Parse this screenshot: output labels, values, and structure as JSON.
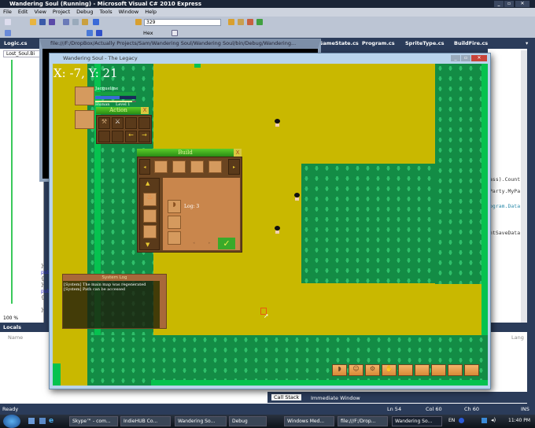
{
  "ide": {
    "title": "Wandering Soul (Running) - Microsoft Visual C# 2010 Express",
    "menu": [
      "File",
      "Edit",
      "View",
      "Project",
      "Debug",
      "Tools",
      "Window",
      "Help"
    ],
    "find_value": "329",
    "hex_label": "Hex",
    "tabs_left": [
      "Logic.cs"
    ],
    "tabs_right": [
      "GameState.cs",
      "Program.cs",
      "SpriteType.cs",
      "BuildFire.cs"
    ],
    "member_dropdown": "Lost_Soul.Bi",
    "code_left": [
      "}",
      "publ",
      "{",
      "}",
      "publ",
      "{",
      "}"
    ],
    "code_right": [
      "ass).Count)",
      "Party.MyPar",
      "ogram.Data.D",
      "ntSaveData]"
    ],
    "zoom": "100 %",
    "locals_title": "Locals",
    "locals_col": "Name",
    "right_col": "Lang",
    "bottom_tabs": [
      "Call Stack",
      "Immediate Window"
    ],
    "status": {
      "ready": "Ready",
      "ln": "Ln 54",
      "col": "Col 60",
      "ch": "Ch 60",
      "mode": "INS"
    }
  },
  "console": {
    "title": "file:///F:/DropBox/Actually Projects/Sam/Wandering Soul/Wandering Soul/bin/Debug/Wandering..."
  },
  "game": {
    "title": "Wandering Soul - The Legacy",
    "coords": "X: -7, Y: 21",
    "player": {
      "name": "Jacqueline",
      "race": "Human",
      "level": "Level 1",
      "health": 1.0,
      "mana": 0.6,
      "xp": 0.9
    },
    "action": {
      "title": "Action",
      "close": "X"
    },
    "build": {
      "title": "Build",
      "close": "X",
      "item": "Log: 3",
      "confirm": "✓"
    },
    "log": {
      "title": "System Log",
      "lines": [
        "[System] The main map was regenerated",
        "[System] Path can be accessed"
      ]
    },
    "hotbar_slots": 9
  },
  "taskbar": {
    "items": [
      "Skype™ - com...",
      "IndieHUB Co...",
      "Wandering So...",
      "Debug",
      "Windows Med...",
      "file:///F:/Drop...",
      "Wandering So..."
    ],
    "lang": "EN",
    "clock": "11:40 PM"
  }
}
